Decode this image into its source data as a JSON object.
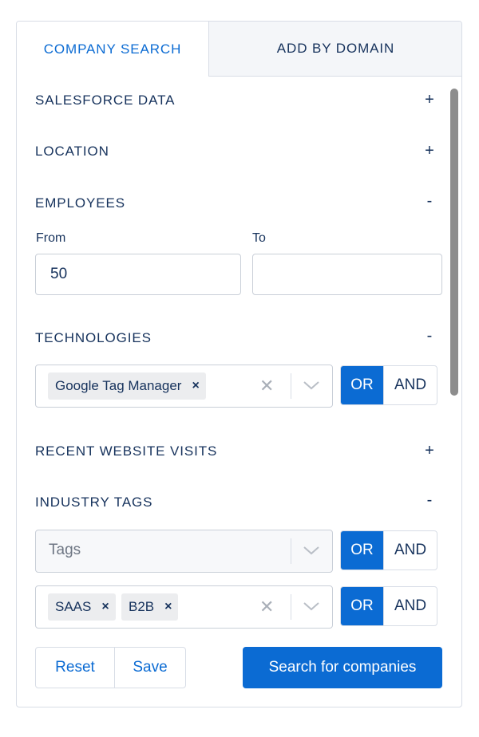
{
  "tabs": {
    "company_search": "COMPANY SEARCH",
    "add_by_domain": "ADD BY DOMAIN"
  },
  "sections": {
    "salesforce": {
      "title": "SALESFORCE DATA",
      "toggle": "+"
    },
    "location": {
      "title": "LOCATION",
      "toggle": "+"
    },
    "employees": {
      "title": "EMPLOYEES",
      "toggle": "-",
      "from_label": "From",
      "from_value": "50",
      "to_label": "To",
      "to_value": ""
    },
    "technologies": {
      "title": "TECHNOLOGIES",
      "toggle": "-",
      "chips": [
        "Google Tag Manager"
      ],
      "or_label": "OR",
      "and_label": "AND"
    },
    "recent_visits": {
      "title": "RECENT WEBSITE VISITS",
      "toggle": "+"
    },
    "industry_tags": {
      "title": "INDUSTRY TAGS",
      "toggle": "-",
      "row1": {
        "placeholder": "Tags",
        "or_label": "OR",
        "and_label": "AND"
      },
      "row2": {
        "chips": [
          "SAAS",
          "B2B"
        ],
        "or_label": "OR",
        "and_label": "AND"
      }
    }
  },
  "actions": {
    "reset": "Reset",
    "save": "Save",
    "search": "Search for companies"
  },
  "chip_remove_glyph": "×",
  "clear_glyph": "✕",
  "colors": {
    "accent": "#0b6bd3",
    "text": "#16325c",
    "border": "#d8dde6"
  }
}
